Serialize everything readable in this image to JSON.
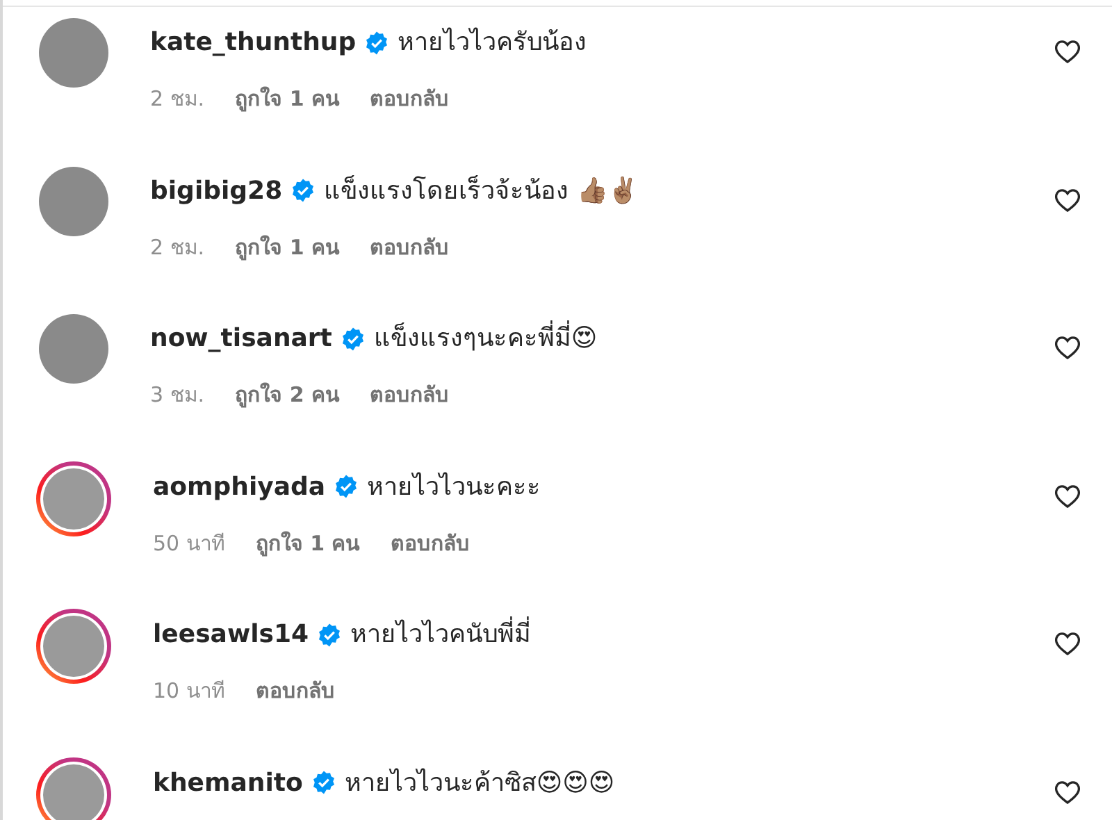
{
  "comments": [
    {
      "username": "kate_thunthup",
      "verified": true,
      "story_ring": false,
      "text": "หายไวไวครับน้อง",
      "time": "2 ชม.",
      "likes": "ถูกใจ 1 คน",
      "reply": "ตอบกลับ"
    },
    {
      "username": "bigibig28",
      "verified": true,
      "story_ring": false,
      "text": "แข็งแรงโดยเร็วจ้ะน้อง 👍🏽✌🏽",
      "time": "2 ชม.",
      "likes": "ถูกใจ 1 คน",
      "reply": "ตอบกลับ"
    },
    {
      "username": "now_tisanart",
      "verified": true,
      "story_ring": false,
      "text": "แข็งแรงๆนะคะพี่มี่😍",
      "time": "3 ชม.",
      "likes": "ถูกใจ 2 คน",
      "reply": "ตอบกลับ"
    },
    {
      "username": "aomphiyada",
      "verified": true,
      "story_ring": true,
      "text": "หายไวไวนะคะะ",
      "time": "50 นาที",
      "likes": "ถูกใจ 1 คน",
      "reply": "ตอบกลับ"
    },
    {
      "username": "leesawls14",
      "verified": true,
      "story_ring": true,
      "text": "หายไวไวคนับพี่มี่",
      "time": "10 นาที",
      "reply": "ตอบกลับ"
    },
    {
      "username": "khemanito",
      "verified": true,
      "story_ring": true,
      "text": "หายไวไวนะค้าซิส😍😍😍"
    }
  ]
}
